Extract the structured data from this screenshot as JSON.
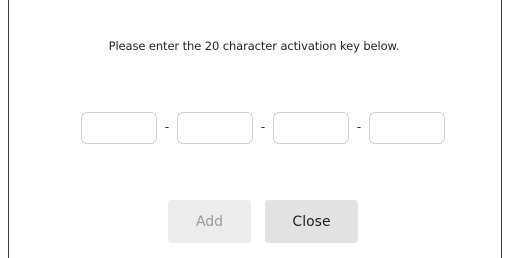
{
  "dialog": {
    "instructions": "Please enter the 20 character activation key below.",
    "key_fields": [
      {
        "value": "",
        "placeholder": ""
      },
      {
        "value": "",
        "placeholder": ""
      },
      {
        "value": "",
        "placeholder": ""
      },
      {
        "value": "",
        "placeholder": ""
      }
    ],
    "separator": "-",
    "buttons": {
      "add_label": "Add",
      "add_enabled": false,
      "close_label": "Close"
    }
  },
  "colors": {
    "field_border": "#cfcfcf",
    "add_button_bg": "#ececec",
    "add_button_text": "#9a9a9a",
    "close_button_bg": "#e2e2e2"
  }
}
